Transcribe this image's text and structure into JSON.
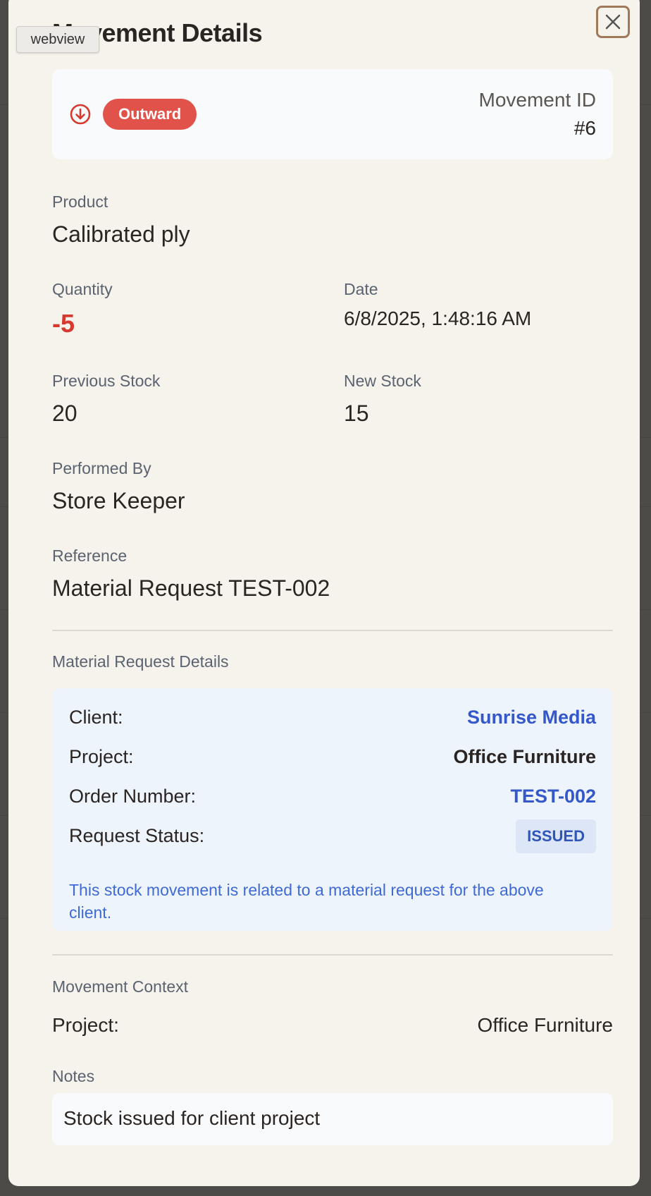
{
  "webview_label": "webview",
  "modal": {
    "title": "Movement Details",
    "close_label": "×"
  },
  "summary": {
    "direction": "Outward",
    "movement_id_label": "Movement ID",
    "movement_id_value": "#6",
    "direction_color": "#e0524a"
  },
  "fields": {
    "product_label": "Product",
    "product_value": "Calibrated ply",
    "quantity_label": "Quantity",
    "quantity_value": "-5",
    "quantity_color": "#d63a2f",
    "date_label": "Date",
    "date_value": "6/8/2025, 1:48:16 AM",
    "previous_stock_label": "Previous Stock",
    "previous_stock_value": "20",
    "new_stock_label": "New Stock",
    "new_stock_value": "15",
    "performed_by_label": "Performed By",
    "performed_by_value": "Store Keeper",
    "reference_label": "Reference",
    "reference_value": "Material Request TEST-002"
  },
  "material_request": {
    "section_title": "Material Request Details",
    "client_label": "Client:",
    "client_value": "Sunrise Media",
    "project_label": "Project:",
    "project_value": "Office Furniture",
    "order_label": "Order Number:",
    "order_value": "TEST-002",
    "status_label": "Request Status:",
    "status_value": "ISSUED",
    "note": "This stock movement is related to a material request for the above client."
  },
  "context": {
    "section_title": "Movement Context",
    "project_label": "Project:",
    "project_value": "Office Furniture"
  },
  "notes": {
    "label": "Notes",
    "value": "Stock issued for client project"
  }
}
